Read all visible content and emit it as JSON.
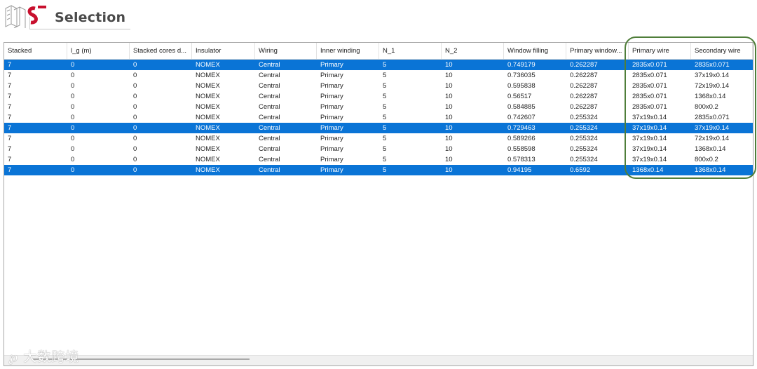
{
  "header": {
    "title": "Selection",
    "logo_icon": "wire-logo-icon"
  },
  "colors": {
    "selection": "#0a74d6",
    "highlight_ring": "#4f7e3a"
  },
  "table": {
    "columns": [
      "Stacked",
      "l_g (m)",
      "Stacked cores d...",
      "Insulator",
      "Wiring",
      "Inner winding",
      "N_1",
      "N_2",
      "Window filling",
      "Primary window...",
      "Primary wire",
      "Secondary wire"
    ],
    "rows": [
      {
        "selected": true,
        "cells": [
          "7",
          "0",
          "0",
          "NOMEX",
          "Central",
          "Primary",
          "5",
          "10",
          "0.749179",
          "0.262287",
          "2835x0.071",
          "2835x0.071"
        ]
      },
      {
        "selected": false,
        "cells": [
          "7",
          "0",
          "0",
          "NOMEX",
          "Central",
          "Primary",
          "5",
          "10",
          "0.736035",
          "0.262287",
          "2835x0.071",
          "37x19x0.14"
        ]
      },
      {
        "selected": false,
        "cells": [
          "7",
          "0",
          "0",
          "NOMEX",
          "Central",
          "Primary",
          "5",
          "10",
          "0.595838",
          "0.262287",
          "2835x0.071",
          "72x19x0.14"
        ]
      },
      {
        "selected": false,
        "cells": [
          "7",
          "0",
          "0",
          "NOMEX",
          "Central",
          "Primary",
          "5",
          "10",
          "0.56517",
          "0.262287",
          "2835x0.071",
          "1368x0.14"
        ]
      },
      {
        "selected": false,
        "cells": [
          "7",
          "0",
          "0",
          "NOMEX",
          "Central",
          "Primary",
          "5",
          "10",
          "0.584885",
          "0.262287",
          "2835x0.071",
          "800x0.2"
        ]
      },
      {
        "selected": false,
        "cells": [
          "7",
          "0",
          "0",
          "NOMEX",
          "Central",
          "Primary",
          "5",
          "10",
          "0.742607",
          "0.255324",
          "37x19x0.14",
          "2835x0.071"
        ]
      },
      {
        "selected": true,
        "cells": [
          "7",
          "0",
          "0",
          "NOMEX",
          "Central",
          "Primary",
          "5",
          "10",
          "0.729463",
          "0.255324",
          "37x19x0.14",
          "37x19x0.14"
        ]
      },
      {
        "selected": false,
        "cells": [
          "7",
          "0",
          "0",
          "NOMEX",
          "Central",
          "Primary",
          "5",
          "10",
          "0.589266",
          "0.255324",
          "37x19x0.14",
          "72x19x0.14"
        ]
      },
      {
        "selected": false,
        "cells": [
          "7",
          "0",
          "0",
          "NOMEX",
          "Central",
          "Primary",
          "5",
          "10",
          "0.558598",
          "0.255324",
          "37x19x0.14",
          "1368x0.14"
        ]
      },
      {
        "selected": false,
        "cells": [
          "7",
          "0",
          "0",
          "NOMEX",
          "Central",
          "Primary",
          "5",
          "10",
          "0.578313",
          "0.255324",
          "37x19x0.14",
          "800x0.2"
        ]
      },
      {
        "selected": true,
        "cells": [
          "7",
          "0",
          "0",
          "NOMEX",
          "Central",
          "Primary",
          "5",
          "10",
          "0.94195",
          "0.6592",
          "1368x0.14",
          "1368x0.14"
        ]
      }
    ]
  },
  "watermark": {
    "text": "大数跨境",
    "icon": "watermark-logo-icon"
  }
}
